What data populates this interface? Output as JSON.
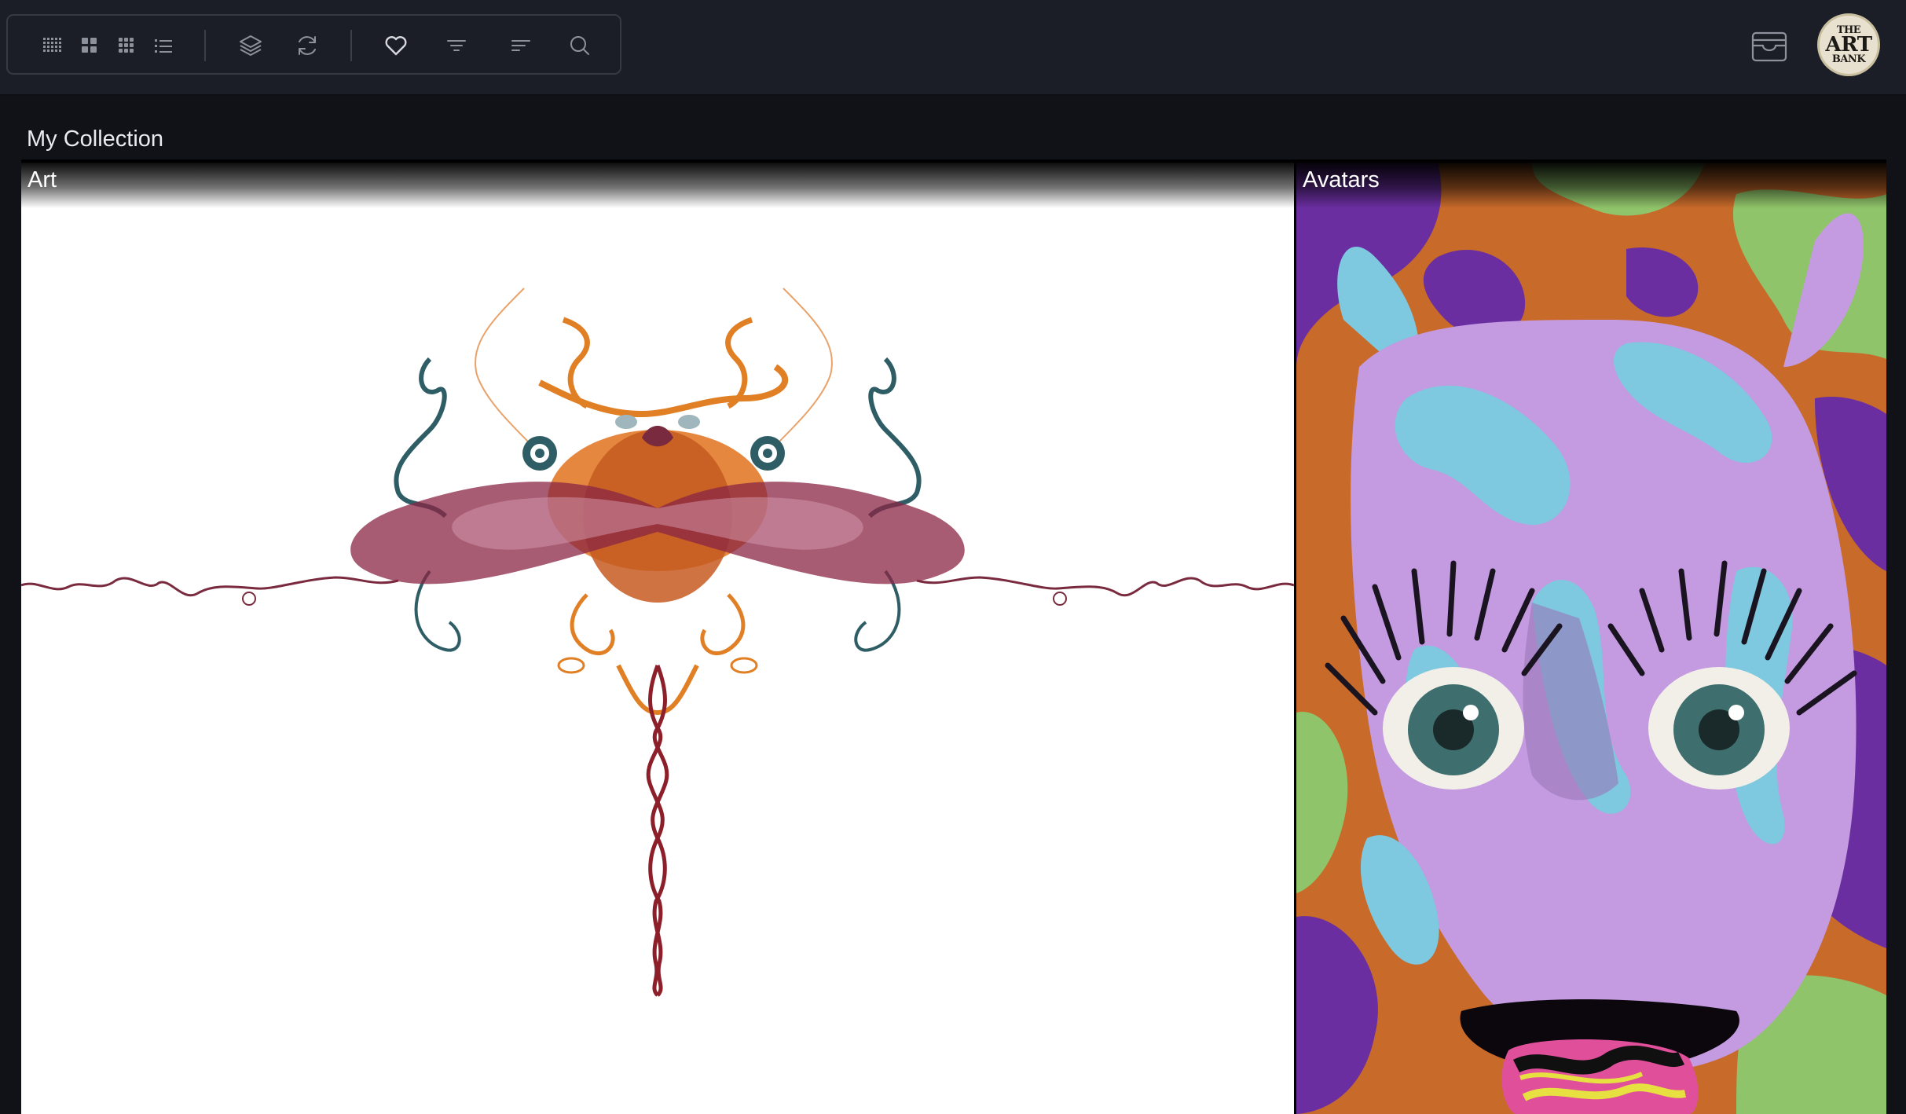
{
  "toolbar": {
    "view_buttons": [
      {
        "icon": "dense-grid-icon"
      },
      {
        "icon": "large-grid-icon"
      },
      {
        "icon": "small-grid-icon"
      },
      {
        "icon": "list-view-icon"
      }
    ],
    "action_buttons": [
      {
        "icon": "layers-icon"
      },
      {
        "icon": "refresh-icon"
      }
    ],
    "filter_buttons": [
      {
        "icon": "heart-icon"
      },
      {
        "icon": "filter-icon"
      },
      {
        "icon": "sort-icon"
      },
      {
        "icon": "search-icon"
      }
    ]
  },
  "header_right": {
    "archive_icon": "archive-icon",
    "avatar_logo": {
      "line1": "THE",
      "line2": "ART",
      "line3": "BANK"
    }
  },
  "main": {
    "section_title": "My Collection",
    "tiles": [
      {
        "label": "Art"
      },
      {
        "label": "Avatars"
      }
    ]
  },
  "colors": {
    "background": "#101217",
    "topbar": "#1b1e27",
    "toolbar_border": "#363a45",
    "icon": "#8d919c",
    "text": "#e9ebf0"
  }
}
